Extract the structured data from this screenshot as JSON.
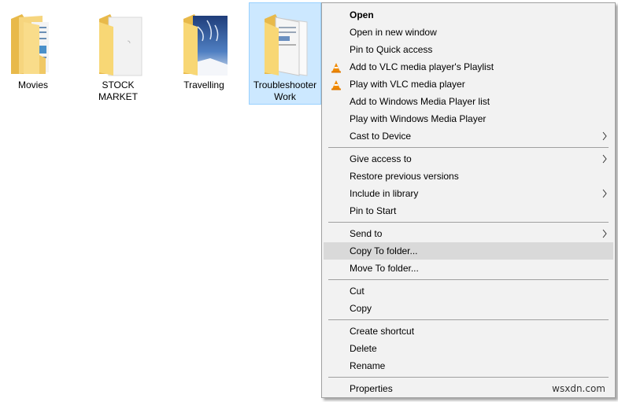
{
  "folders": [
    {
      "name": "Movies",
      "selected": false
    },
    {
      "name": "STOCK MARKET",
      "selected": false
    },
    {
      "name": "Travelling",
      "selected": false
    },
    {
      "name": "Troubleshooter Work",
      "selected": true
    }
  ],
  "context_menu": {
    "groups": [
      [
        {
          "label": "Open",
          "bold": true
        },
        {
          "label": "Open in new window"
        },
        {
          "label": "Pin to Quick access"
        },
        {
          "label": "Add to VLC media player's Playlist",
          "icon": "vlc-cone-icon"
        },
        {
          "label": "Play with VLC media player",
          "icon": "vlc-cone-icon"
        },
        {
          "label": "Add to Windows Media Player list"
        },
        {
          "label": "Play with Windows Media Player"
        },
        {
          "label": "Cast to Device",
          "submenu": true
        }
      ],
      [
        {
          "label": "Give access to",
          "submenu": true
        },
        {
          "label": "Restore previous versions"
        },
        {
          "label": "Include in library",
          "submenu": true
        },
        {
          "label": "Pin to Start"
        }
      ],
      [
        {
          "label": "Send to",
          "submenu": true
        },
        {
          "label": "Copy To folder...",
          "highlighted": true
        },
        {
          "label": "Move To folder..."
        }
      ],
      [
        {
          "label": "Cut"
        },
        {
          "label": "Copy"
        }
      ],
      [
        {
          "label": "Create shortcut"
        },
        {
          "label": "Delete"
        },
        {
          "label": "Rename"
        }
      ],
      [
        {
          "label": "Properties"
        }
      ]
    ]
  },
  "watermark": "wsxdn.com",
  "colors": {
    "selection_bg": "#cce8ff",
    "selection_border": "#99d1ff",
    "menu_bg": "#f2f2f2",
    "menu_hover": "#d9d9d9",
    "folder_yellow": "#f8d775",
    "vlc_orange": "#f08a00"
  }
}
